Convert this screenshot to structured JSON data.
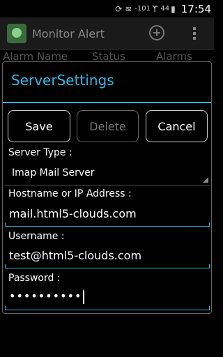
{
  "statusbar": {
    "signal_text": "-101",
    "signal_sub": "44",
    "time": "17:54"
  },
  "actionbar": {
    "title": "Monitor Alert"
  },
  "background_columns": [
    "Alarm Name",
    "Status",
    "Alarms"
  ],
  "dialog": {
    "title": "ServerSettings",
    "buttons": {
      "save": "Save",
      "delete": "Delete",
      "cancel": "Cancel"
    },
    "server_type_label": "Server Type :",
    "server_type_value": "Imap Mail Server",
    "hostname_label": "Hostname or IP Address :",
    "hostname_value": "mail.html5-clouds.com",
    "username_label": "Username :",
    "username_value": "test@html5-clouds.com",
    "password_label": "Password :",
    "password_value": "••••••••••"
  },
  "colors": {
    "accent": "#33b5e5",
    "background": "#000000"
  }
}
